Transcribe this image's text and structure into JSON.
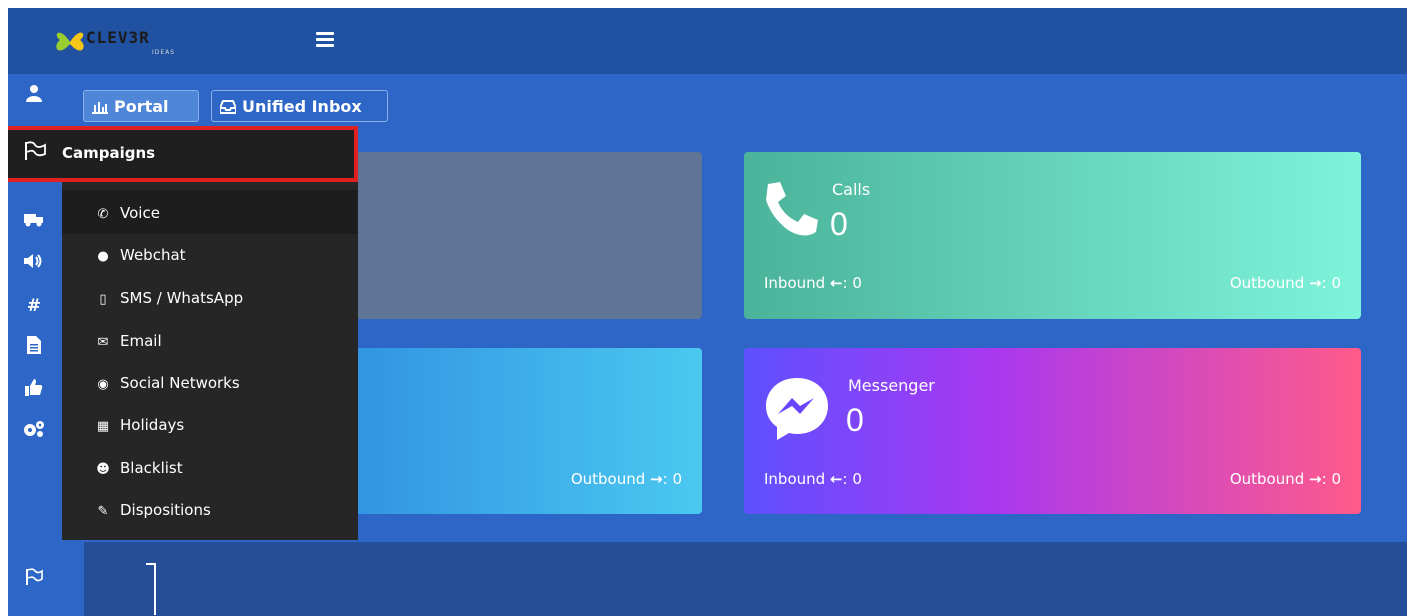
{
  "app": {
    "logo_text": "CLEV3R",
    "logo_sub": "IDEAS"
  },
  "tabs": {
    "portal": "Portal",
    "inbox": "Unified Inbox"
  },
  "menu": {
    "header": "Campaigns",
    "items": [
      {
        "label": "Voice",
        "icon": "phone-icon"
      },
      {
        "label": "Webchat",
        "icon": "chat-icon"
      },
      {
        "label": "SMS / WhatsApp",
        "icon": "mobile-icon"
      },
      {
        "label": "Email",
        "icon": "envelope-icon"
      },
      {
        "label": "Social Networks",
        "icon": "globe-icon"
      },
      {
        "label": "Holidays",
        "icon": "calendar-icon"
      },
      {
        "label": "Blacklist",
        "icon": "user-block-icon"
      },
      {
        "label": "Dispositions",
        "icon": "pencil-icon"
      }
    ]
  },
  "cards": {
    "calls": {
      "title": "Calls",
      "value": "0",
      "inbound": "Inbound",
      "inbound_value": ": 0",
      "outbound": "Outbound",
      "outbound_value": ": 0"
    },
    "blue": {
      "outbound": "Outbound",
      "outbound_value": ": 0"
    },
    "messenger": {
      "title": "Messenger",
      "value": "0",
      "inbound": "Inbound",
      "inbound_value": ": 0",
      "outbound": "Outbound",
      "outbound_value": ": 0"
    }
  },
  "colors": {
    "topbar": "#2052a1",
    "content": "#2d66c7",
    "highlight": "#e12121"
  }
}
